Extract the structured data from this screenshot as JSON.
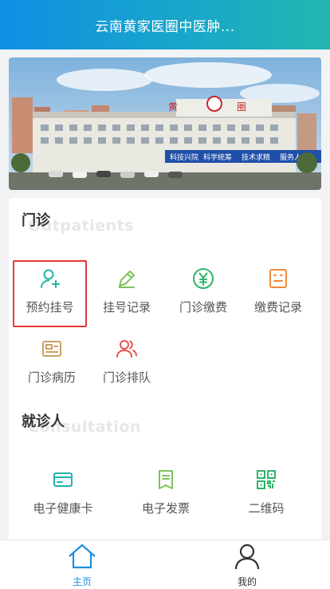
{
  "header": {
    "title": "云南黄家医圈中医肿..."
  },
  "banner": {
    "alt": "hospital-building-photo",
    "signs": [
      "科技兴院",
      "科学统筹",
      "技术求精",
      "服务人民"
    ]
  },
  "outpatient": {
    "title": "门诊",
    "subtitle": "Outpatients",
    "items": [
      {
        "label": "预约挂号",
        "icon": "user-add-icon",
        "color": "#1fb5a8"
      },
      {
        "label": "挂号记录",
        "icon": "pencil-icon",
        "color": "#7cc35b"
      },
      {
        "label": "门诊缴费",
        "icon": "yuan-icon",
        "color": "#2db36a"
      },
      {
        "label": "缴费记录",
        "icon": "receipt-icon",
        "color": "#f08a3c"
      },
      {
        "label": "门诊病历",
        "icon": "id-card-icon",
        "color": "#c9a064"
      },
      {
        "label": "门诊排队",
        "icon": "queue-users-icon",
        "color": "#e8544e"
      }
    ]
  },
  "consultation": {
    "title": "就诊人",
    "subtitle": "Consultation",
    "items": [
      {
        "label": "电子健康卡",
        "icon": "card-icon",
        "color": "#22b3b0"
      },
      {
        "label": "电子发票",
        "icon": "invoice-icon",
        "color": "#7cc35b"
      },
      {
        "label": "二维码",
        "icon": "qr-code-icon",
        "color": "#2db36a"
      }
    ]
  },
  "tabbar": {
    "items": [
      {
        "label": "主页",
        "active": true
      },
      {
        "label": "我的",
        "active": false
      }
    ],
    "active_color": "#1a8fe0",
    "inactive_color": "#333333"
  }
}
